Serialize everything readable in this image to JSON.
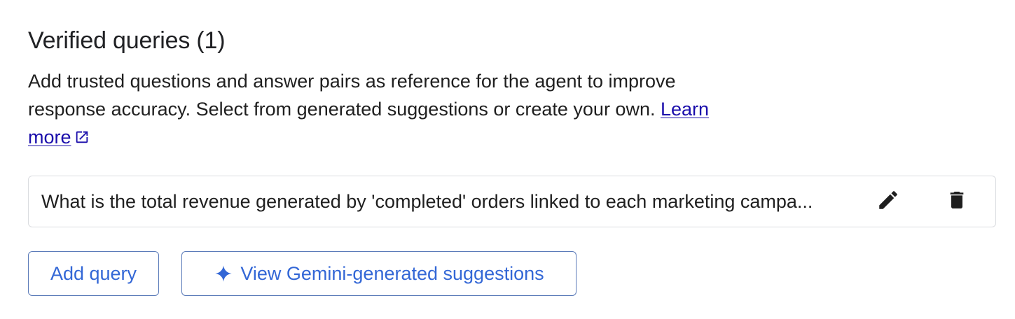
{
  "section": {
    "title": "Verified queries (1)",
    "description": "Add trusted questions and answer pairs as reference for the agent to improve response accuracy. Select from generated suggestions or create your own.",
    "learn_more_label": "Learn more"
  },
  "queries": [
    {
      "text": "What is the total revenue generated by 'completed' orders linked to each marketing campa..."
    }
  ],
  "actions": {
    "add_query_label": "Add query",
    "gemini_label": "View Gemini-generated suggestions"
  },
  "icons": {
    "external_link": "external-link-icon",
    "edit": "pencil-icon",
    "delete": "trash-icon",
    "spark": "sparkle-icon"
  },
  "colors": {
    "link": "#1a0dab",
    "button_text": "#3367d6",
    "button_border": "#5b7bb9",
    "row_border": "#dadce0",
    "icon": "#1f1f1f"
  }
}
